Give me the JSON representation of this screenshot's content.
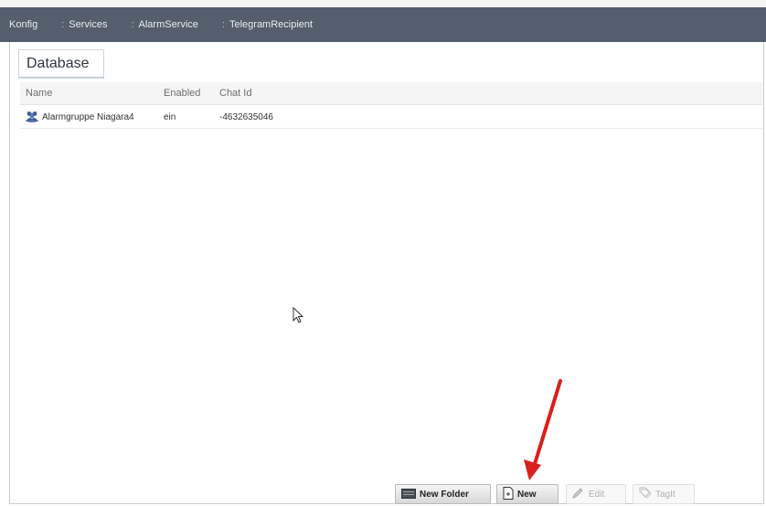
{
  "breadcrumb": [
    "Konfig",
    "Services",
    "AlarmService",
    "TelegramRecipient"
  ],
  "tab": {
    "label": "Database"
  },
  "table": {
    "columns": [
      "Name",
      "Enabled",
      "Chat Id"
    ],
    "rows": [
      {
        "icon": "user-group-icon",
        "name": "Alarmgruppe Niagara4",
        "enabled": "ein",
        "chat_id": "-4632635046"
      }
    ]
  },
  "toolbar": {
    "new_folder": "New Folder",
    "new": "New",
    "edit": "Edit",
    "tagit": "TagIt"
  },
  "colors": {
    "header_bar": "#545e6c",
    "annotation_arrow": "#d9201c"
  }
}
